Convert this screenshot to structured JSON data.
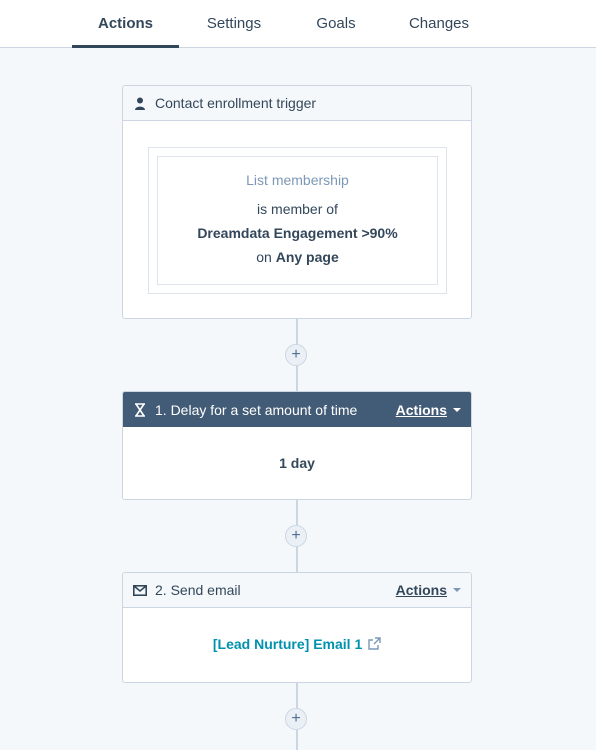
{
  "tabs": [
    {
      "label": "Actions",
      "active": true
    },
    {
      "label": "Settings",
      "active": false
    },
    {
      "label": "Goals",
      "active": false
    },
    {
      "label": "Changes",
      "active": false
    }
  ],
  "trigger": {
    "icon": "user-icon",
    "title": "Contact enrollment trigger",
    "filter_type": "List membership",
    "condition": "is member of",
    "list_name": "Dreamdata Engagement >90%",
    "on_prefix": "on",
    "on_value": "Any page"
  },
  "steps": [
    {
      "icon": "hourglass-icon",
      "title": "1. Delay for a set amount of time",
      "actions_label": "Actions",
      "body": "1 day"
    },
    {
      "icon": "envelope-icon",
      "title": "2. Send email",
      "actions_label": "Actions",
      "body": "[Lead Nurture] Email 1",
      "body_icon": "external-link-icon"
    }
  ],
  "add_action_symbol": "+",
  "colors": {
    "header_dark": "#425b76",
    "link": "#0091ae",
    "text": "#33475b",
    "background": "#f5f8fa"
  }
}
